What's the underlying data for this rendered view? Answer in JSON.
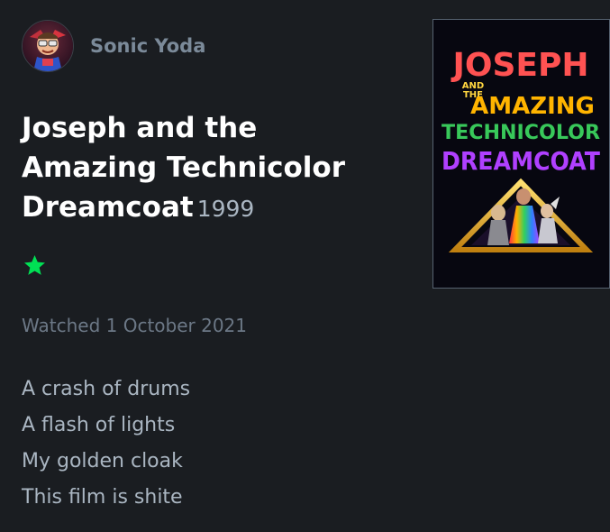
{
  "user": {
    "name": "Sonic Yoda",
    "avatar_icon": "avatar-icon"
  },
  "film": {
    "title": "Joseph and the Amazing Technicolor Dreamcoat",
    "year": "1999"
  },
  "rating": {
    "stars": 1,
    "max_stars": 5,
    "icon": "star-icon",
    "color": "#00e054"
  },
  "watched": "Watched 1 October 2021",
  "review": {
    "lines": [
      "A crash of drums",
      "A flash of lights",
      "My golden cloak",
      "This film is shite"
    ]
  },
  "poster": {
    "lines": [
      {
        "text": "JOSEPH",
        "color": "#ff5252"
      },
      {
        "text": "AND",
        "color": "#ffd640"
      },
      {
        "text": "THE",
        "color": "#ffd640"
      },
      {
        "text": "AMAZING",
        "color": "#ffb400"
      },
      {
        "text": "TECHNICOLOR",
        "color": "#38c85a"
      },
      {
        "text": "DREAMCOAT",
        "color": "#b040ff"
      }
    ]
  },
  "colors": {
    "background": "#1a1d21",
    "username": "#7b8a99",
    "muted": "#6c7886",
    "body_text": "#aab6c2",
    "title": "#ffffff",
    "star": "#00e054"
  }
}
